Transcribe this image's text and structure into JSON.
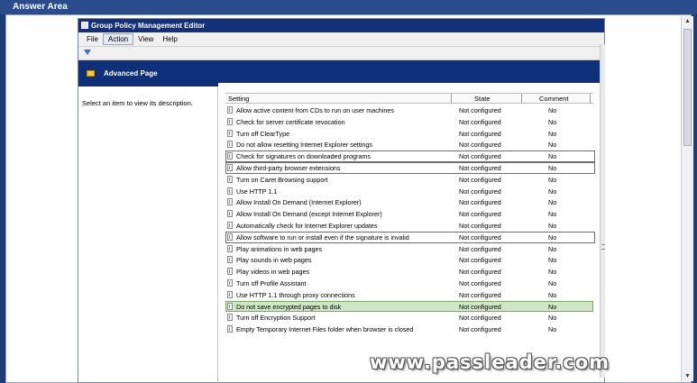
{
  "answer_area": {
    "label": "Answer Area"
  },
  "window": {
    "title": "Group Policy Management Editor"
  },
  "menu": [
    {
      "label": "File"
    },
    {
      "label": "Action"
    },
    {
      "label": "View"
    },
    {
      "label": "Help"
    }
  ],
  "header": {
    "title": "Advanced Page"
  },
  "description": {
    "text": "Select an item to view its description."
  },
  "columns": {
    "setting": "Setting",
    "state": "State",
    "comment": "Comment"
  },
  "rows": [
    {
      "setting": "Allow active content from CDs to run on user machines",
      "state": "Not configured",
      "comment": "No"
    },
    {
      "setting": "Check for server certificate revocation",
      "state": "Not configured",
      "comment": "No"
    },
    {
      "setting": "Turn off ClearType",
      "state": "Not configured",
      "comment": "No"
    },
    {
      "setting": "Do not allow resetting Internet Explorer settings",
      "state": "Not configured",
      "comment": "No"
    },
    {
      "setting": "Check for signatures on downloaded programs",
      "state": "Not configured",
      "comment": "No"
    },
    {
      "setting": "Allow third-party browser extensions",
      "state": "Not configured",
      "comment": "No"
    },
    {
      "setting": "Turn on Caret Browsing support",
      "state": "Not configured",
      "comment": "No"
    },
    {
      "setting": "Use HTTP 1.1",
      "state": "Not configured",
      "comment": "No"
    },
    {
      "setting": "Allow Install On Demand (Internet Explorer)",
      "state": "Not configured",
      "comment": "No"
    },
    {
      "setting": "Allow Install On Demand (except Internet Explorer)",
      "state": "Not configured",
      "comment": "No"
    },
    {
      "setting": "Automatically check for Internet Explorer updates",
      "state": "Not configured",
      "comment": "No"
    },
    {
      "setting": "Allow software to run or install even if the signature is invalid",
      "state": "Not configured",
      "comment": "No"
    },
    {
      "setting": "Play animations in web pages",
      "state": "Not configured",
      "comment": "No"
    },
    {
      "setting": "Play sounds in web pages",
      "state": "Not configured",
      "comment": "No"
    },
    {
      "setting": "Play videos in web pages",
      "state": "Not configured",
      "comment": "No"
    },
    {
      "setting": "Turn off Profile Assistant",
      "state": "Not configured",
      "comment": "No"
    },
    {
      "setting": "Use HTTP 1.1 through proxy connections",
      "state": "Not configured",
      "comment": "No"
    },
    {
      "setting": "Do not save encrypted pages to disk",
      "state": "Not configured",
      "comment": "No"
    },
    {
      "setting": "Turn off Encryption Support",
      "state": "Not configured",
      "comment": "No"
    },
    {
      "setting": "Empty Temporary Internet Files folder when browser is closed",
      "state": "Not configured",
      "comment": "No"
    }
  ],
  "watermark": {
    "text": "www.passleader.com"
  },
  "colors": {
    "title_bar": "#14307a",
    "header_band": "#0f2f78",
    "selected_row": "#cfe7c4"
  }
}
